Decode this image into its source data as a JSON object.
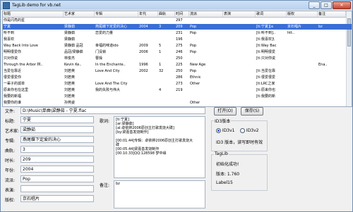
{
  "window": {
    "title": "TagLib demo for vb.net",
    "minimize": "_",
    "maximize": "□",
    "close": "✕"
  },
  "grid": {
    "headers": [
      "标题",
      "艺术家",
      "专辑",
      "年代",
      "曲轨",
      "时间",
      "流派",
      "表演",
      "歌词",
      "版权",
      "备注"
    ],
    "rows": [
      [
        "你是闪亮的星",
        "",
        "",
        "",
        "",
        "297",
        "",
        "",
        "",
        "",
        ""
      ],
      [
        "宁夏",
        "梁静茹",
        "燕尾蝶下定爱的决心",
        "2004",
        "3",
        "209",
        "Pop",
        "",
        "[ti:宁夏][a",
        "京石唱片",
        "bz"
      ],
      [
        "听不到",
        "梁静茹",
        "恋爱的力量",
        "",
        "",
        "231",
        "Pop",
        "",
        "[ti:听不到]..",
        "htt..",
        ""
      ],
      [
        "我喜欢",
        "梁静茹",
        "",
        "",
        "",
        "196",
        "",
        "",
        "[ti:我喜欢]\\",
        "",
        ""
      ],
      [
        "Way Back Into Love",
        "梁静茹 品冠",
        "幸福的味道ido",
        "2009",
        "5",
        "275",
        "Pop",
        "",
        "[ti:Way Bac",
        "",
        ""
      ],
      [
        "明明很爱你",
        "品冠/梁静茹",
        "门没锁",
        "2006",
        "1",
        "246",
        "Pop",
        "",
        "[ti:明明很爱",
        "",
        ""
      ],
      [
        "只对你说",
        "林俊杰",
        "曹操",
        "",
        "",
        "250",
        "",
        "",
        "[ti:只对你说",
        "",
        ""
      ],
      [
        "Through the Arbor 林..",
        "Kevin Ke..",
        "In the Enchante..",
        "1996",
        "1",
        "225",
        "New Age",
        "",
        "",
        "",
        "Ena.."
      ],
      [
        "当爱在靠近",
        "刘若英",
        "Love And City",
        "2002",
        "32",
        "250",
        "Pop",
        "",
        "[ti:当爱在靠",
        "",
        ""
      ],
      [
        "很爱很爱你",
        "刘若英",
        "",
        "",
        "",
        "286",
        "Ethnic",
        "",
        "[ti:很爱很爱",
        "",
        ""
      ],
      [
        "一辈子的孤单",
        "刘若英",
        "Love And The City",
        "",
        "",
        "273",
        "Other",
        "",
        "[ti:LRC之家",
        "",
        ""
      ],
      [
        "原来你也在这里",
        "刘若英",
        "我的失败与伟大",
        "",
        "4",
        "219",
        "",
        "",
        "[ti:原来你也",
        "",
        ""
      ],
      [
        "我要的新福",
        "刘若英",
        "",
        "",
        "",
        "",
        "",
        "",
        "[ti:我要的新",
        "",
        ""
      ],
      [
        "我要你的谁",
        "孙燕姿",
        "",
        "",
        "",
        "",
        "Other",
        "",
        "",
        "",
        ""
      ]
    ]
  },
  "form": {
    "file_label": "文件:",
    "file_value": "D:\\Music\\单曲\\梁静茹 - 宁夏.flac",
    "open_button": "打开(O)",
    "save_button": "保存(S)",
    "fields": [
      {
        "label": "标题:",
        "value": "宁夏"
      },
      {
        "label": "艺术家:",
        "value": "梁静茹"
      },
      {
        "label": "专辑:",
        "value": "燕尾蝶下定爱的决心"
      },
      {
        "label": "曲轨:",
        "value": "3"
      },
      {
        "label": "时长:",
        "value": "209"
      },
      {
        "label": "年份:",
        "value": "2004"
      },
      {
        "label": "流派:",
        "value": "Pop"
      },
      {
        "label": "表演:",
        "value": ""
      },
      {
        "label": "版权:",
        "value": "京石唱片"
      }
    ],
    "lyrics_label": "歌词:",
    "lyrics_text": "[ti:宁夏]\n[ar:梁静茹]\n[al:卓依婷2006原创主打歌发烧大碟]\n[by:梁嘉善发烧制作]\n\n[00:01.44]专辑：卓依婷2006原创主打歌发烧大\n碟\n[00:05.44]梁嘉善发烧制作\n[00:10.33]QQ:128598 梦中缘",
    "comment_label": "备注:",
    "comment_value": "bz"
  },
  "id3": {
    "group_title": "ID3版本",
    "options": [
      "ID3v1",
      "ID3v2"
    ],
    "selected": "ID3v1",
    "note": "ID3 版本，读写即时有效"
  },
  "taglib": {
    "group_title": "TagLib",
    "status": "初始化成功!",
    "version": "版本: 1.760",
    "label": "Label15"
  }
}
